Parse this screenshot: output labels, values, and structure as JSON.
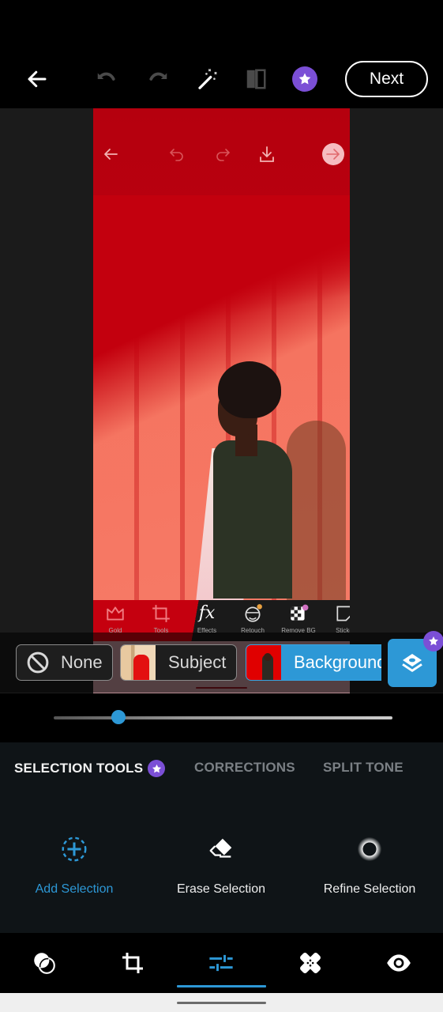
{
  "toolbar": {
    "back_icon": "arrow-left-icon",
    "undo_icon": "undo-icon",
    "redo_icon": "redo-icon",
    "auto_fix_icon": "magic-wand-icon",
    "compare_icon": "before-after-compare-icon",
    "premium_icon": "premium-star-icon",
    "next_label": "Next"
  },
  "photo": {
    "overlay_nav_icons": [
      "arrow-left-icon",
      "undo-icon",
      "redo-icon",
      "download-icon",
      "arrow-right-circle-icon"
    ],
    "embedded_tools": [
      {
        "label": "Gold",
        "icon": "crown-icon"
      },
      {
        "label": "Tools",
        "icon": "crop-icon"
      },
      {
        "label": "Effects",
        "icon": "fx-icon"
      },
      {
        "label": "Retouch",
        "icon": "face-retouch-icon"
      },
      {
        "label": "Remove BG",
        "icon": "remove-bg-icon"
      },
      {
        "label": "Sticke",
        "icon": "sticker-icon"
      }
    ]
  },
  "selection_chips": [
    {
      "label": "None",
      "icon": "no-symbol-icon",
      "selected": false
    },
    {
      "label": "Subject",
      "selected": false
    },
    {
      "label": "Background",
      "selected": true
    }
  ],
  "layers_button": {
    "icon": "layers-icon",
    "badge": "premium-star-icon"
  },
  "slider": {
    "value_fraction": 0.19
  },
  "panel": {
    "tabs": [
      {
        "label": "SELECTION TOOLS",
        "active": true,
        "premium": true
      },
      {
        "label": "CORRECTIONS",
        "active": false
      },
      {
        "label": "SPLIT TONE",
        "active": false
      }
    ],
    "tools": [
      {
        "label": "Add Selection",
        "icon": "add-selection-icon",
        "active": true
      },
      {
        "label": "Erase Selection",
        "icon": "eraser-icon",
        "active": false
      },
      {
        "label": "Refine Selection",
        "icon": "refine-circle-icon",
        "active": false
      }
    ]
  },
  "bottom_nav": [
    {
      "name": "looks",
      "icon": "looks-circles-icon",
      "active": false
    },
    {
      "name": "crop",
      "icon": "crop-icon",
      "active": false
    },
    {
      "name": "adjustments",
      "icon": "sliders-icon",
      "active": true
    },
    {
      "name": "heal",
      "icon": "bandage-icon",
      "active": false
    },
    {
      "name": "preview",
      "icon": "eye-icon",
      "active": false
    }
  ],
  "colors": {
    "accent": "#2d98d6",
    "premium": "#7b4fd6",
    "panel_bg": "#0f1417"
  }
}
